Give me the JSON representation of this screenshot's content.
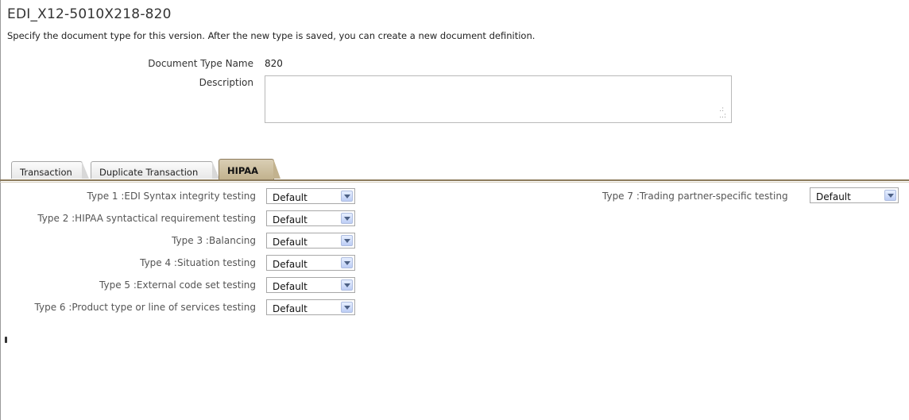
{
  "header": {
    "title": "EDI_X12-5010X218-820",
    "intro": "Specify the document type for this version. After the new type is saved, you can create a new document definition."
  },
  "form": {
    "doc_type_name_label": "Document Type Name",
    "doc_type_name_value": "820",
    "description_label": "Description",
    "description_value": ""
  },
  "tabs": [
    {
      "label": "Transaction",
      "active": false
    },
    {
      "label": "Duplicate Transaction",
      "active": false
    },
    {
      "label": "HIPAA",
      "active": true
    }
  ],
  "hipaa": {
    "rows": [
      {
        "label": "Type 1 :EDI Syntax integrity testing",
        "value": "Default"
      },
      {
        "label": "Type 2 :HIPAA syntactical requirement testing",
        "value": "Default"
      },
      {
        "label": "Type 3 :Balancing",
        "value": "Default"
      },
      {
        "label": "Type 4 :Situation testing",
        "value": "Default"
      },
      {
        "label": "Type 5 :External code set testing",
        "value": "Default"
      },
      {
        "label": "Type 6 :Product type or line of services testing",
        "value": "Default"
      }
    ],
    "type7": {
      "label": "Type 7 :Trading partner-specific testing",
      "value": "Default"
    }
  },
  "icons": {
    "dropdown": "chevron-down-icon",
    "resize": "resize-grip-icon"
  },
  "colors": {
    "active_tab": "#c2b28e",
    "tab_rule": "#8c7b5c",
    "dropdown_button": "#bccdf5"
  }
}
